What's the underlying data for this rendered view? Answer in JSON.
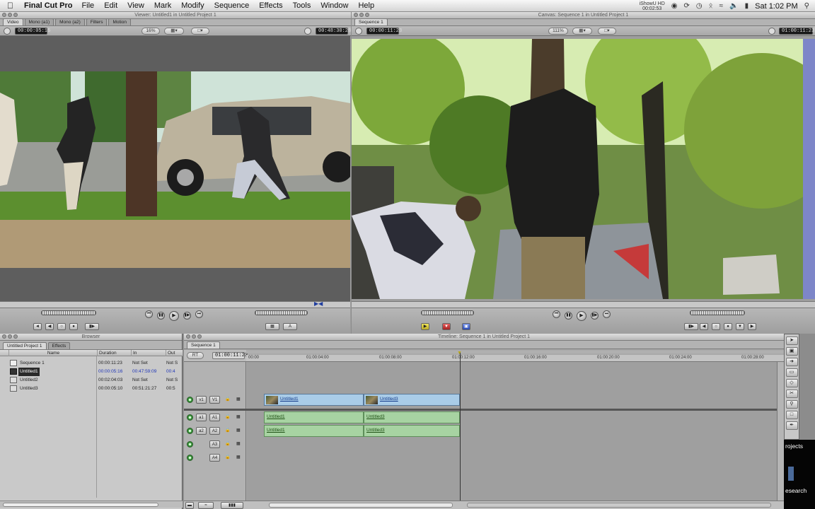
{
  "menubar": {
    "apple": "",
    "app_name": "Final Cut Pro",
    "items": [
      "File",
      "Edit",
      "View",
      "Mark",
      "Modify",
      "Sequence",
      "Effects",
      "Tools",
      "Window",
      "Help"
    ],
    "showhd_line1": "iShowU HD",
    "showhd_line2": "00:02:53",
    "clock": "Sat 1:02 PM"
  },
  "viewer": {
    "title": "Viewer: Untitled1 in Untitled Project 1",
    "tabs": [
      "Video",
      "Mono (a1)",
      "Mono (a2)",
      "Filters",
      "Motion"
    ],
    "duration_tc": "00:00:05:16",
    "zoom": "16%",
    "current_tc": "00:48:30:28"
  },
  "canvas": {
    "title": "Canvas: Sequence 1 in Untitled Project 1",
    "tab": "Sequence 1",
    "duration_tc": "00:00:11:23",
    "zoom": "111%",
    "current_tc": "01:00:11:23"
  },
  "browser": {
    "title": "Browser",
    "tabs": [
      "Untitled Project 1",
      "Effects"
    ],
    "columns": [
      "Name",
      "Duration",
      "In",
      "Out"
    ],
    "rows": [
      {
        "name": "Sequence 1",
        "duration": "00:00:11:23",
        "in": "Not Set",
        "out": "Not S"
      },
      {
        "name": "Untitled1",
        "duration": "00:00:05:16",
        "in": "00:47:59:09",
        "out": "00:4"
      },
      {
        "name": "Untitled2",
        "duration": "00:02:04:03",
        "in": "Not Set",
        "out": "Not S"
      },
      {
        "name": "Untitled3",
        "duration": "00:00:05:10",
        "in": "00:51:21:27",
        "out": "00:5"
      }
    ]
  },
  "timeline": {
    "title": "Timeline: Sequence 1 in Untitled Project 1",
    "tab": "Sequence 1",
    "rt": "RT",
    "current_tc": "01:00:11:23",
    "ruler": [
      "00:00",
      "01:00:04:00",
      "01:00:08:00",
      "01:00:12:00",
      "01:00:16:00",
      "01:00:20:00",
      "01:00:24:00",
      "01:00:28:00"
    ],
    "tracks": {
      "v1_src": "v1",
      "v1_dst": "V1",
      "a1_src": "a1",
      "a1_dst": "A1",
      "a2_src": "a2",
      "a2_dst": "A2",
      "a3": "A3",
      "a4": "A4"
    },
    "clips": {
      "v1_clip1": "Untitled1",
      "v1_clip2": "Untitled3",
      "a1_clip1": "Untitled1",
      "a1_clip2": "Untitled3",
      "a2_clip1": "Untitled1",
      "a2_clip2": "Untitled3"
    }
  },
  "desktop": {
    "label1": "rojects",
    "label2": "esearch"
  }
}
